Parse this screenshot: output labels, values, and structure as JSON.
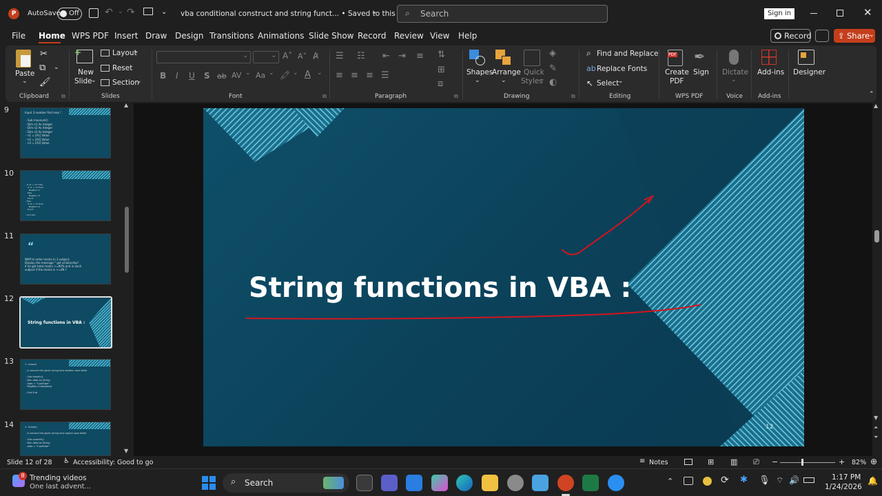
{
  "titlebar": {
    "autosave_label": "AutoSave",
    "autosave_state": "Off",
    "doc_title": "vba conditional construct and string funct... • Saved to this PC",
    "search_placeholder": "Search",
    "sign_in": "Sign in"
  },
  "menu_tabs": [
    "File",
    "Home",
    "WPS PDF",
    "Insert",
    "Draw",
    "Design",
    "Transitions",
    "Animations",
    "Slide Show",
    "Record",
    "Review",
    "View",
    "Help"
  ],
  "actions": {
    "record": "Record",
    "share": "Share"
  },
  "ribbon": {
    "clipboard": {
      "paste": "Paste",
      "group": "Clipboard"
    },
    "slides": {
      "new_slide": "New",
      "new_slide2": "Slide",
      "layout": "Layout",
      "reset": "Reset",
      "section": "Section",
      "group": "Slides"
    },
    "font": {
      "group": "Font",
      "bold": "B",
      "italic": "I",
      "underline": "U",
      "shadow": "S",
      "strike": "ab",
      "spacing": "AV",
      "case": "Aa"
    },
    "paragraph": {
      "group": "Paragraph"
    },
    "drawing": {
      "shapes": "Shapes",
      "arrange": "Arrange",
      "quick_styles": "Quick",
      "quick_styles2": "Styles",
      "group": "Drawing"
    },
    "editing": {
      "find_replace": "Find and Replace",
      "replace_fonts": "Replace Fonts",
      "select": "Select",
      "group": "Editing"
    },
    "wps": {
      "create_pdf": "Create",
      "create_pdf2": "PDF",
      "sign": "Sign",
      "group": "WPS PDF"
    },
    "voice": {
      "dictate": "Dictate",
      "group": "Voice"
    },
    "addins": {
      "addins": "Add-ins",
      "group": "Add-ins"
    },
    "designer": {
      "designer": "Designer"
    }
  },
  "thumbnails": [
    {
      "num": "9",
      "text": "Input 3 number find max !\n\n - Sub maxnum()\n - Dim n1 As Integer\n - Dim n2 As Integer\n - Dim n3 As Integer\n - n1 = [A1].Value\n - n2 = [A2].Value\n - n3 = [A3].Value"
    },
    {
      "num": "10",
      "text": " - If n1 > n2 Then\n    If n1 > n3 Then\n      MsgBox n1\n    Else\n      MsgBox n3\n    End If\n - Else\n    If n2 > n3 Then\n      MsgBox n2\n    End If\n\n - End Sub"
    },
    {
      "num": "11",
      "text": "WAP to enter marks in 3 subject.\nDisplay the message \" got scholarship\"\nif he got total marks >=90% and in each\nsubject if the marks is >=89.?"
    },
    {
      "num": "12",
      "text": "String functions in VBA :"
    },
    {
      "num": "13",
      "text": "1. Lcase()\n\n - it convert the given string into smaller case letter\n\n - Sub lcasefn()\n - Dim data As String\n - data = \"CoolTube\"\n - MsgBox LCase(data)\n\n - End Sub"
    },
    {
      "num": "14",
      "text": "2. Ucase()\n\n - it convert the given string into capital case letter\n\n - Sub ucasefn()\n - Dim data As String\n - data = \"CoolTube\""
    }
  ],
  "slide": {
    "title": "String functions in VBA :",
    "page_number": "12"
  },
  "status": {
    "slide_of": "Slide 12 of 28",
    "accessibility": "Accessibility: Good to go",
    "notes": "Notes",
    "zoom": "82%"
  },
  "taskbar": {
    "widget_badge": "8",
    "widget_title": "Trending videos",
    "widget_sub": "One last advent...",
    "search": "Search",
    "time": "1:17 PM",
    "date": "1/24/2026"
  },
  "colors": {
    "accent": "#c43e1c",
    "slide_bg": "#0b4159",
    "stripe": "#5fc4dc",
    "ink": "#d6141d"
  }
}
